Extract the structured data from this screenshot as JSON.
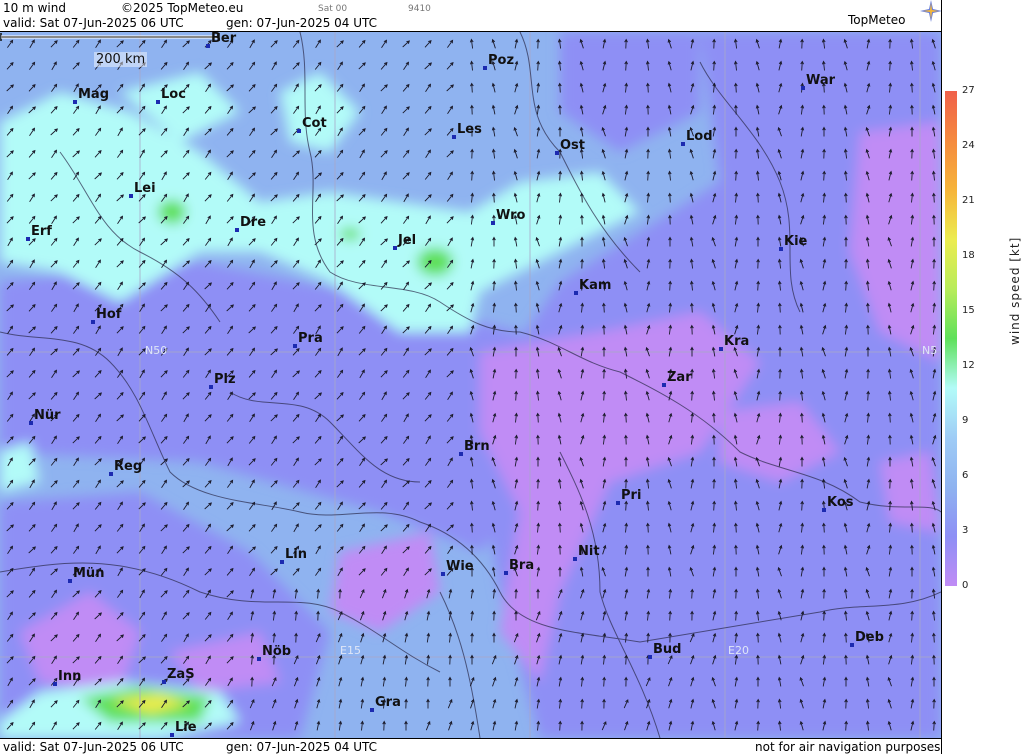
{
  "header": {
    "product": "10 m wind",
    "copyright": "©2025 TopMeteo.eu",
    "valid": "valid:  Sat  07-Jun-2025  06 UTC",
    "gen": "gen: 07-Jun-2025 04 UTC",
    "sat": "Sat 00",
    "code": "9410",
    "logo": "TopMeteo"
  },
  "scale_label": "200 km",
  "grid_labels": [
    {
      "id": "n50",
      "text": "N50"
    },
    {
      "id": "n50r",
      "text": "N5"
    },
    {
      "id": "e15",
      "text": "E15"
    },
    {
      "id": "e20",
      "text": "E20"
    }
  ],
  "cities": [
    {
      "name": "Ber"
    },
    {
      "name": "Poz"
    },
    {
      "name": "Mag"
    },
    {
      "name": "Loc"
    },
    {
      "name": "War"
    },
    {
      "name": "Cot"
    },
    {
      "name": "Les"
    },
    {
      "name": "Lod"
    },
    {
      "name": "Ost"
    },
    {
      "name": "Lei"
    },
    {
      "name": "Dre"
    },
    {
      "name": "Wro"
    },
    {
      "name": "Erf"
    },
    {
      "name": "Jel"
    },
    {
      "name": "Kie"
    },
    {
      "name": "Kam"
    },
    {
      "name": "Hof"
    },
    {
      "name": "Pra"
    },
    {
      "name": "Kra"
    },
    {
      "name": "Zar"
    },
    {
      "name": "Plz"
    },
    {
      "name": "Nür"
    },
    {
      "name": "Brn"
    },
    {
      "name": "Reg"
    },
    {
      "name": "Pri"
    },
    {
      "name": "Kos"
    },
    {
      "name": "Lin"
    },
    {
      "name": "Nit"
    },
    {
      "name": "Bra"
    },
    {
      "name": "Wie"
    },
    {
      "name": "Mün"
    },
    {
      "name": "Bud"
    },
    {
      "name": "Deb"
    },
    {
      "name": "Nöb"
    },
    {
      "name": "Inn"
    },
    {
      "name": "ZaS"
    },
    {
      "name": "Gra"
    },
    {
      "name": "Lie"
    }
  ],
  "legend": {
    "title": "wind speed [kt]",
    "ticks": [
      "27",
      "24",
      "21",
      "18",
      "15",
      "12",
      "9",
      "6",
      "3",
      "0"
    ],
    "colors": [
      "#f0604a",
      "#f58a3f",
      "#f6b43a",
      "#ecec50",
      "#b8ec5a",
      "#5ee05a",
      "#b2fbf8",
      "#9fccf6",
      "#8fb3f0",
      "#8e8ff5",
      "#c08cf5"
    ]
  },
  "footer": {
    "valid": "valid:  Sat  07-Jun-2025  06 UTC",
    "gen": "gen: 07-Jun-2025 04 UTC",
    "disclaimer": "not for air navigation purposes"
  }
}
